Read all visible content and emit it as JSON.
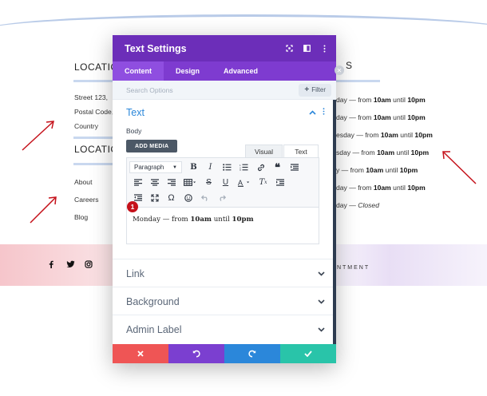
{
  "background": {
    "heading_location_1": "LOCATIO",
    "heading_location_2": "LOCATIO",
    "heading_right_fragment": "S",
    "address": [
      "Street 123,",
      "Postal Code,",
      "Country"
    ],
    "links": [
      "About",
      "Careers",
      "Blog"
    ],
    "hours": [
      {
        "day": "day — from ",
        "start": "10am",
        "mid": " until ",
        "end": "10pm"
      },
      {
        "day": "day — from ",
        "start": "10am",
        "mid": " until ",
        "end": "10pm"
      },
      {
        "day": "esday — from ",
        "start": "10am",
        "mid": " until ",
        "end": "10pm"
      },
      {
        "day": "sday — from ",
        "start": "10am",
        "mid": " until ",
        "end": "10pm"
      },
      {
        "day": "y — from ",
        "start": "10am",
        "mid": " until ",
        "end": "10pm"
      },
      {
        "day": "day — from ",
        "start": "10am",
        "mid": " until ",
        "end": "10pm"
      }
    ],
    "closed_prefix": "day — ",
    "closed_label": "Closed",
    "footer_link": "INTMENT",
    "social_icons": [
      "facebook-icon",
      "twitter-icon",
      "instagram-icon"
    ],
    "accent_color": "#c5111a"
  },
  "modal": {
    "title": "Text Settings",
    "header_icons": [
      "expand-icon",
      "sidebar-icon",
      "more-icon"
    ],
    "tabs": [
      "Content",
      "Design",
      "Advanced"
    ],
    "active_tab": "Content",
    "search_placeholder": "Search Options",
    "filter_label": "Filter",
    "sections": {
      "text": "Text",
      "link": "Link",
      "background": "Background",
      "admin_label": "Admin Label"
    },
    "body_label": "Body",
    "add_media_label": "ADD MEDIA",
    "editor_tabs": [
      "Visual",
      "Text"
    ],
    "format_select": "Paragraph",
    "badge": "1",
    "editor_content": {
      "prefix": "Monday — from ",
      "start": "10am",
      "mid": " until ",
      "end": "10pm"
    },
    "footer_colors": {
      "cancel": "#ef5555",
      "undo": "#7b3fd0",
      "redo": "#2b87da",
      "save": "#29c4a9"
    },
    "header_color": "#6c2eb9",
    "tabs_color": "#7e3bd0"
  }
}
